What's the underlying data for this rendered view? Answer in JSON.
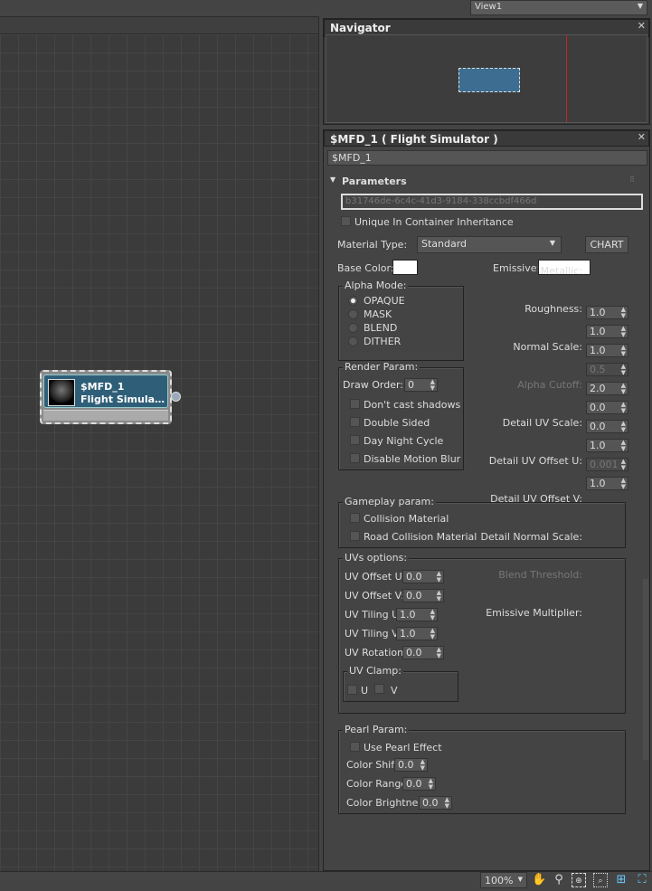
{
  "view_selector": {
    "label": "View1"
  },
  "node": {
    "title": "$MFD_1",
    "subtitle": "Flight  Simula…"
  },
  "navigator": {
    "title": "Navigator"
  },
  "properties": {
    "title": "$MFD_1  ( Flight Simulator )",
    "name_value": "$MFD_1",
    "rollout_title": "Parameters",
    "guid": "b31746de-6c4c-41d3-9184-338ccbdf466d",
    "unique_label": "Unique In Container Inheritance",
    "material_type_label": "Material Type:",
    "material_type_value": "Standard",
    "chart_button": "CHART",
    "base_color_label": "Base Color:",
    "emissive_label": "Emissive:",
    "alpha_mode": {
      "title": "Alpha Mode:",
      "options": [
        "OPAQUE",
        "MASK",
        "BLEND",
        "DITHER"
      ],
      "selected": "OPAQUE"
    },
    "render_param": {
      "title": "Render Param:",
      "draw_order_label": "Draw Order:",
      "draw_order_value": "0",
      "checks": [
        "Don't cast shadows",
        "Double Sided",
        "Day Night Cycle",
        "Disable Motion Blur"
      ]
    },
    "params": [
      {
        "label": "Metallic:",
        "value": "1.0",
        "disabled": false
      },
      {
        "label": "Roughness:",
        "value": "1.0",
        "disabled": false
      },
      {
        "label": "Normal Scale:",
        "value": "1.0",
        "disabled": false
      },
      {
        "label": "Alpha Cutoff:",
        "value": "0.5",
        "disabled": true
      },
      {
        "label": "Detail UV Scale:",
        "value": "2.0",
        "disabled": false
      },
      {
        "label": "Detail UV Offset U:",
        "value": "0.0",
        "disabled": false
      },
      {
        "label": "Detail UV Offset V:",
        "value": "0.0",
        "disabled": false
      },
      {
        "label": "Detail Normal Scale:",
        "value": "1.0",
        "disabled": false
      },
      {
        "label": "Blend Threshold:",
        "value": "0.001",
        "disabled": true
      },
      {
        "label": "Emissive Multiplier:",
        "value": "1.0",
        "disabled": false
      }
    ],
    "gameplay": {
      "title": "Gameplay param:",
      "checks": [
        "Collision Material",
        "Road Collision Material"
      ]
    },
    "uvs": {
      "title": "UVs options:",
      "fields": [
        {
          "label": "UV Offset U:",
          "value": "0.0"
        },
        {
          "label": "UV Offset V:",
          "value": "0.0"
        },
        {
          "label": "UV Tiling U:",
          "value": "1.0"
        },
        {
          "label": "UV Tiling V:",
          "value": "1.0"
        },
        {
          "label": "UV Rotation:",
          "value": "0.0"
        }
      ],
      "clamp_title": "UV Clamp:",
      "clamp_u": "U",
      "clamp_v": "V"
    },
    "pearl": {
      "title": "Pearl Param:",
      "use_label": "Use Pearl Effect",
      "fields": [
        {
          "label": "Color Shift",
          "value": "0.0"
        },
        {
          "label": "Color Range",
          "value": "0.0"
        },
        {
          "label": "Color Brightness",
          "value": "0.0"
        }
      ]
    }
  },
  "status": {
    "zoom": "100%"
  },
  "colors": {
    "base_color": "#ffffff",
    "emissive": "#ffffff",
    "node_header": "#2f5f78"
  }
}
